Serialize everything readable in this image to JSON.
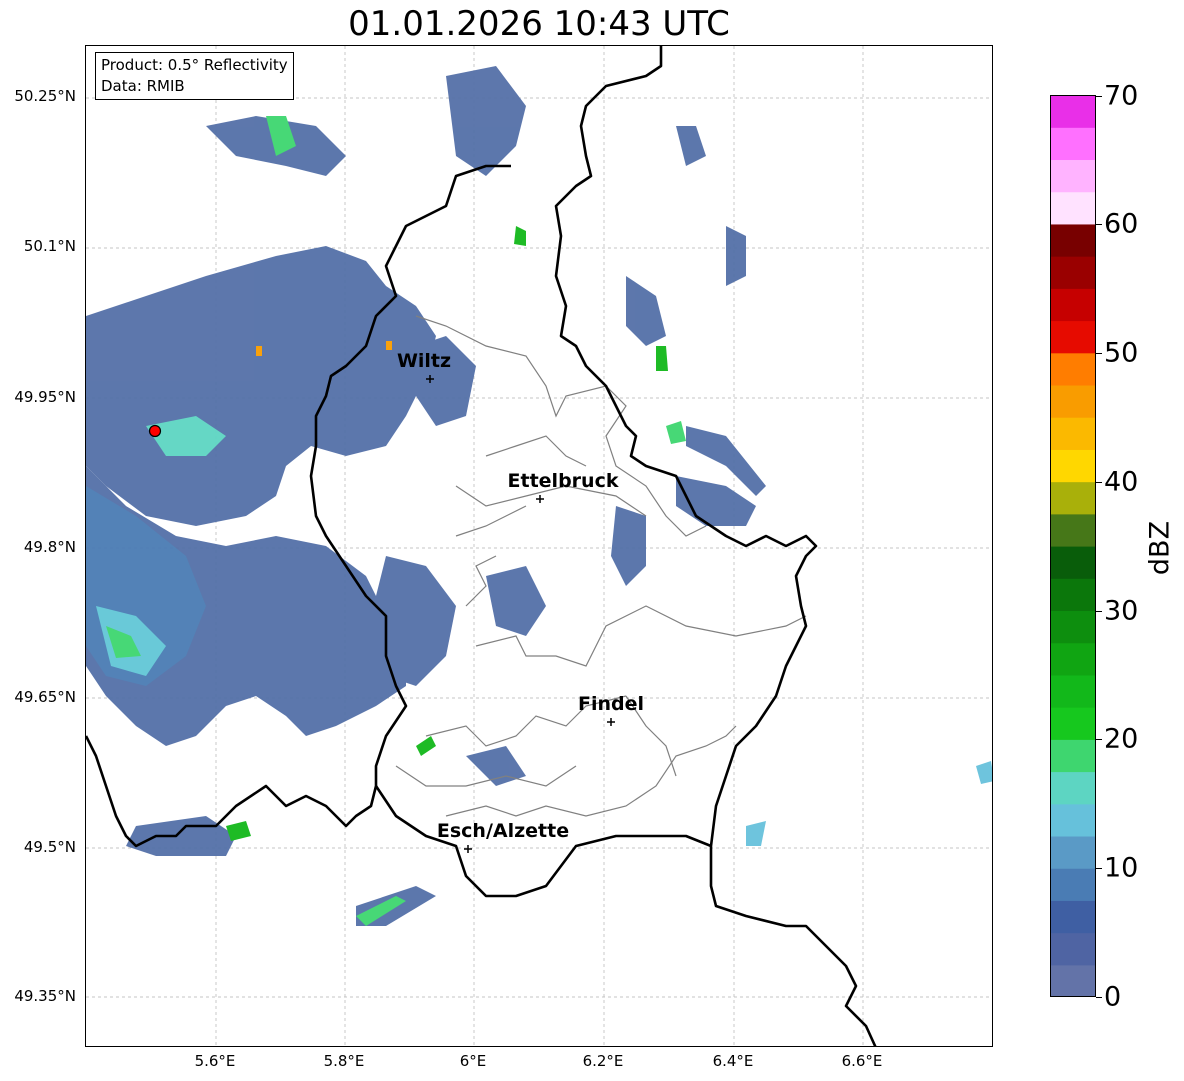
{
  "title": "01.01.2026 10:43 UTC",
  "info": {
    "product": "Product: 0.5° Reflectivity",
    "data": "Data: RMIB"
  },
  "y_axis_ticks": [
    "50.25°N",
    "50.1°N",
    "49.95°N",
    "49.8°N",
    "49.65°N",
    "49.5°N",
    "49.35°N"
  ],
  "x_axis_ticks": [
    "5.6°E",
    "5.8°E",
    "6°E",
    "6.2°E",
    "6.4°E",
    "6.6°E"
  ],
  "colorbar": {
    "label": "dBZ",
    "ticks": [
      "0",
      "10",
      "20",
      "30",
      "40",
      "50",
      "60",
      "70"
    ],
    "colors": [
      "#6373a8",
      "#4f64a3",
      "#3f5fa3",
      "#4a7cb4",
      "#5a9ac6",
      "#66c1db",
      "#5dd5c2",
      "#3ed66f",
      "#16c81e",
      "#12b81a",
      "#10a512",
      "#0d8e0e",
      "#0b770b",
      "#095d0a",
      "#467718",
      "#a9b00a",
      "#ffd700",
      "#fbb900",
      "#f99c00",
      "#ff7d00",
      "#e60b00",
      "#c60000",
      "#9a0000",
      "#780000",
      "#ffe2ff",
      "#ffb3ff",
      "#ff70ff",
      "#e92fe8"
    ]
  },
  "cities": [
    {
      "name": "Wiltz"
    },
    {
      "name": "Ettelbruck"
    },
    {
      "name": "Findel"
    },
    {
      "name": "Esch/Alzette"
    }
  ],
  "radar_site": {
    "color": "#ff0000"
  }
}
